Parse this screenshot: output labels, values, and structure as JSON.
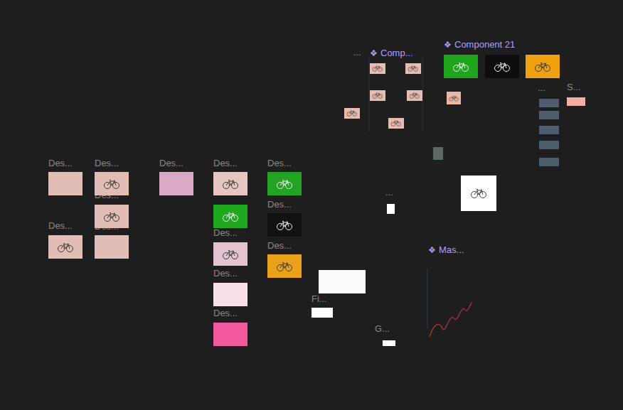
{
  "canvas": {
    "labels": [
      {
        "text": "Des...",
        "component": false,
        "icon": ""
      },
      {
        "text": "Des...",
        "component": false,
        "icon": ""
      },
      {
        "text": "Des...",
        "component": false,
        "icon": ""
      },
      {
        "text": "Des...",
        "component": false,
        "icon": ""
      },
      {
        "text": "Des...",
        "component": false,
        "icon": ""
      },
      {
        "text": "Des...",
        "component": false,
        "icon": ""
      },
      {
        "text": "Des...",
        "component": false,
        "icon": ""
      },
      {
        "text": "Des...",
        "component": false,
        "icon": ""
      },
      {
        "text": "Des...",
        "component": false,
        "icon": ""
      },
      {
        "text": "Des...",
        "component": false,
        "icon": ""
      },
      {
        "text": "Des...",
        "component": false,
        "icon": ""
      },
      {
        "text": "Des...",
        "component": false,
        "icon": ""
      },
      {
        "text": "Des...",
        "component": false,
        "icon": ""
      },
      {
        "text": "Fi...",
        "component": false,
        "icon": ""
      },
      {
        "text": "G...",
        "component": false,
        "icon": ""
      },
      {
        "text": "...",
        "component": false,
        "icon": ""
      },
      {
        "text": "...",
        "component": false,
        "icon": ""
      },
      {
        "text": "...",
        "component": false,
        "icon": ""
      },
      {
        "text": "S...",
        "component": false,
        "icon": ""
      },
      {
        "text": "Comp...",
        "component": true,
        "icon": "❖"
      },
      {
        "text": "Component 21",
        "component": true,
        "icon": "❖"
      },
      {
        "text": "Mas...",
        "component": true,
        "icon": "❖"
      }
    ],
    "frames": [
      {
        "color": "#e2bdb5",
        "bike": false
      },
      {
        "color": "#e2bdb5",
        "bike": true
      },
      {
        "color": "#e2bdb5",
        "bike": true
      },
      {
        "color": "#e2bdb5",
        "bike": true
      },
      {
        "color": "#e2bdb5",
        "bike": false
      },
      {
        "color": "#d9a8c4",
        "bike": false
      },
      {
        "color": "#e6c6c2",
        "bike": true
      },
      {
        "color": "#20a81e",
        "bike": true
      },
      {
        "color": "#e3c3d2",
        "bike": true
      },
      {
        "color": "#f7e0ea",
        "bike": false
      },
      {
        "color": "#f2589c",
        "bike": false
      },
      {
        "color": "#22a322",
        "bike": true
      },
      {
        "color": "#111111",
        "bike": true
      },
      {
        "color": "#eba21a",
        "bike": true
      },
      {
        "color": "#1fa51c",
        "bike": true
      },
      {
        "color": "#0d0d0d",
        "bike": true
      },
      {
        "color": "#f0a10f",
        "bike": true
      },
      {
        "color": "#e8bcb2",
        "bike": true
      },
      {
        "color": "#e8bcb2",
        "bike": true
      },
      {
        "color": "#e8bcb2",
        "bike": true
      },
      {
        "color": "#e8bcb2",
        "bike": true
      },
      {
        "color": "#e8bcb2",
        "bike": true
      },
      {
        "color": "#e8bcb2",
        "bike": true
      },
      {
        "color": "#eab6a6",
        "bike": true
      },
      {
        "color": "#4d5d6b",
        "bike": false
      },
      {
        "color": "#4d5d6b",
        "bike": false
      },
      {
        "color": "#4d5d6b",
        "bike": false
      },
      {
        "color": "#4d5d6b",
        "bike": false
      },
      {
        "color": "#4d5d6b",
        "bike": false
      },
      {
        "color": "#f3b0a0",
        "bike": false
      },
      {
        "color": "#ffffff",
        "bike": true
      },
      {
        "color": "#fbfbfb",
        "bike": false
      },
      {
        "color": "#ffffff",
        "bike": false
      },
      {
        "color": "#ffffff",
        "bike": false
      },
      {
        "color": "#ffffff",
        "bike": false
      },
      {
        "color": "#5b6a66",
        "bike": false
      }
    ]
  }
}
